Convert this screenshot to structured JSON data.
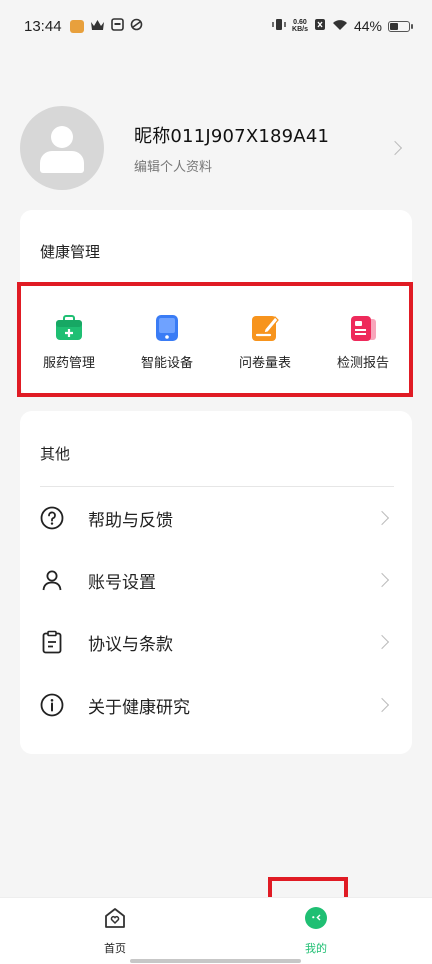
{
  "status_bar": {
    "time": "13:44",
    "speed_value": "0.60",
    "speed_unit": "KB/s",
    "battery": "44%",
    "battery_level": 0.44
  },
  "profile": {
    "nickname": "昵称011J907X189A41",
    "edit_label": "编辑个人资料"
  },
  "health": {
    "title": "健康管理",
    "items": [
      {
        "label": "服药管理",
        "icon": "medicine-kit-icon",
        "color": "#1fbf73"
      },
      {
        "label": "智能设备",
        "icon": "smart-device-icon",
        "color": "#3a7cf5"
      },
      {
        "label": "问卷量表",
        "icon": "questionnaire-icon",
        "color": "#f7941d"
      },
      {
        "label": "检测报告",
        "icon": "test-report-icon",
        "color": "#ee2a5b"
      }
    ]
  },
  "other": {
    "title": "其他",
    "items": [
      {
        "label": "帮助与反馈",
        "icon": "help-icon"
      },
      {
        "label": "账号设置",
        "icon": "account-icon"
      },
      {
        "label": "协议与条款",
        "icon": "clipboard-icon"
      },
      {
        "label": "关于健康研究",
        "icon": "info-icon"
      }
    ]
  },
  "tabbar": {
    "home_label": "首页",
    "mine_label": "我的",
    "active_color": "#1fbf73"
  }
}
